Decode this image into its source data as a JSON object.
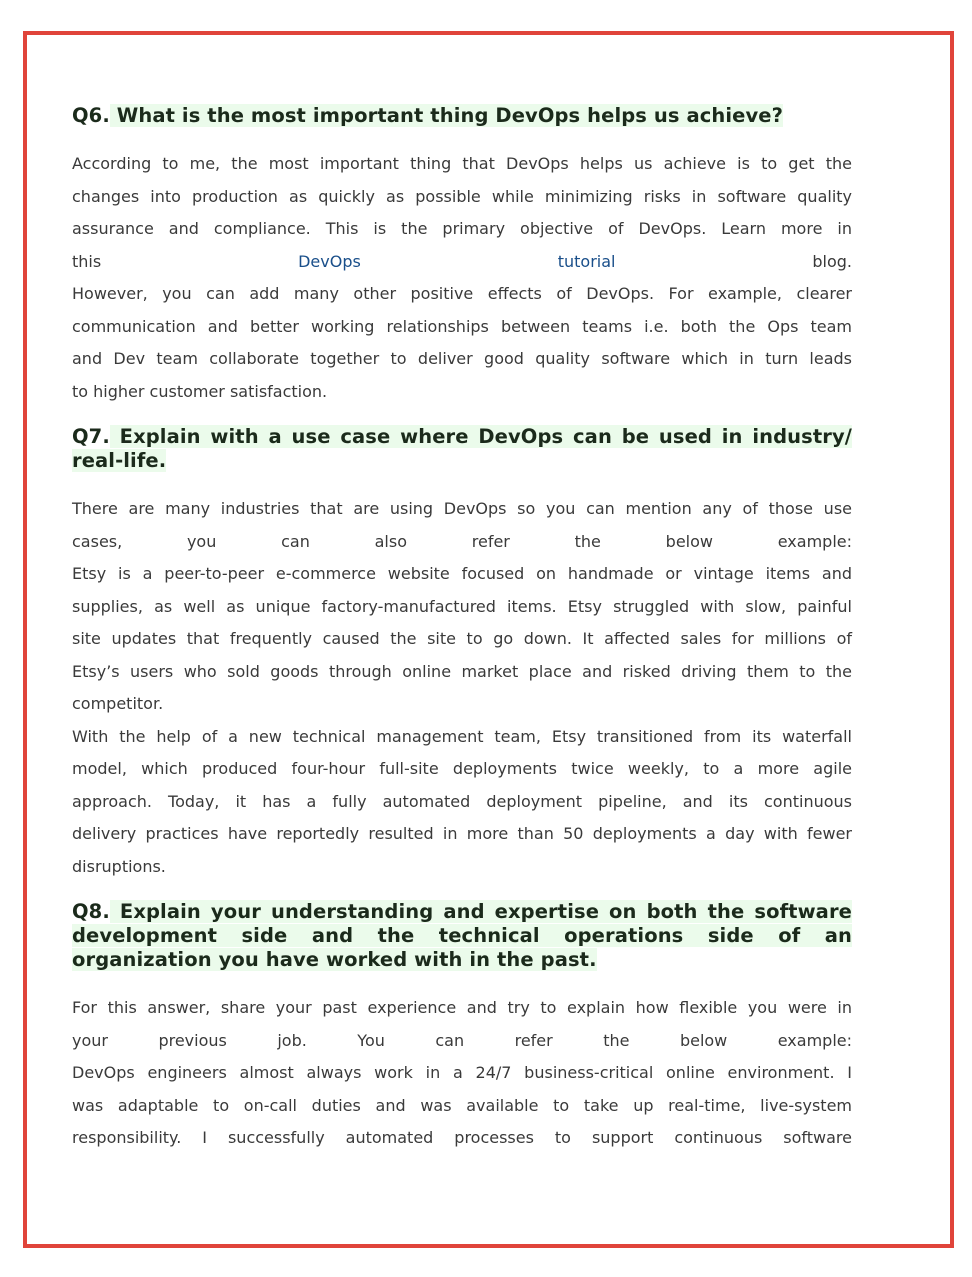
{
  "frame_color": "#e0443a",
  "highlight_color": "#ebfbeb",
  "link_color": "#1a4f8a",
  "sections": [
    {
      "number": "Q6.",
      "question": " What is the most important thing DevOps helps us achieve?",
      "answer_lines": [
        "According to me, the most important thing that DevOps helps us achieve is to get the",
        "changes into production as quickly as possible while minimizing risks in software quality",
        "assurance and compliance. This is the primary objective of DevOps. Learn more in",
        {
          "prefix": "this ",
          "link1": "DevOps",
          "link2": "tutorial",
          "suffix": " blog."
        },
        "However, you can add many other positive effects of DevOps. For example, clearer",
        "communication and better working relationships between teams i.e. both the Ops team",
        "and Dev team collaborate together to deliver good quality software which in turn leads",
        "to higher customer satisfaction."
      ]
    },
    {
      "number": "Q7.",
      "question": " Explain with a use case where DevOps can be used in industry/ real-life.",
      "answer_lines": [
        "There are many industries that are using DevOps so you can mention any of those use",
        "cases, you can also refer the below example:",
        "Etsy is a peer-to-peer e-commerce website focused on handmade or vintage items and",
        "supplies, as well as unique factory-manufactured items. Etsy struggled with slow, painful",
        "site updates that frequently caused the site to go down. It affected sales for millions of",
        "Etsy’s users who sold goods through online market place and risked driving them to the",
        "competitor.",
        "With the help of a new technical management team, Etsy transitioned from its waterfall",
        "model, which produced four-hour full-site deployments twice weekly, to a more agile",
        "approach. Today, it has a fully automated deployment pipeline, and its continuous",
        "delivery practices have reportedly resulted in more than 50 deployments a day with fewer",
        "disruptions."
      ]
    },
    {
      "number": "Q8.",
      "question": " Explain your understanding and expertise on both the software development side and the technical operations side of an organization you have worked with in the past.",
      "answer_lines": [
        "For this answer, share your past experience and try to explain how flexible you were in",
        "your previous job. You can refer the below example:",
        "DevOps engineers almost always work in a 24/7 business-critical online environment. I",
        "was adaptable to on-call duties and was available to take up real-time, live-system",
        "responsibility. I successfully automated processes to support continuous software"
      ]
    }
  ]
}
